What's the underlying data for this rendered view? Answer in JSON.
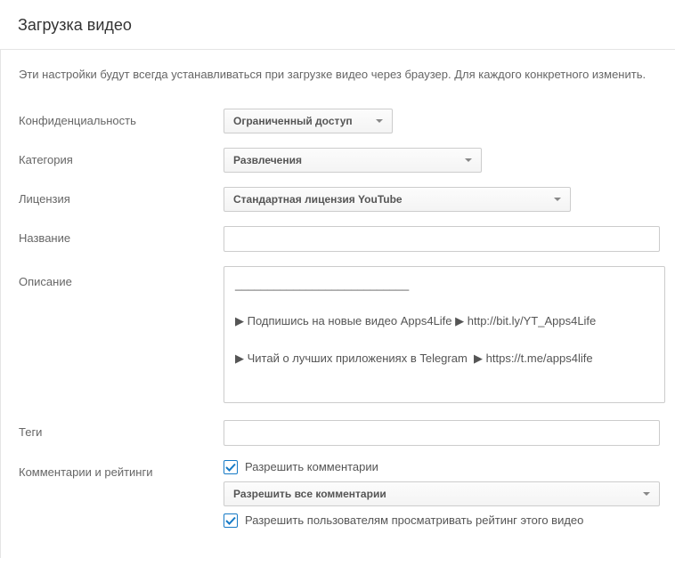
{
  "header": {
    "title": "Загрузка видео"
  },
  "intro": "Эти настройки будут всегда устанавливаться при загрузке видео через браузер. Для каждого конкретного изменить.",
  "privacy": {
    "label": "Конфиденциальность",
    "value": "Ограниченный доступ"
  },
  "category": {
    "label": "Категория",
    "value": "Развлечения"
  },
  "license": {
    "label": "Лицензия",
    "value": "Стандартная лицензия YouTube"
  },
  "title_field": {
    "label": "Название",
    "value": ""
  },
  "description": {
    "label": "Описание",
    "value": "___________________________\n\n▶ Подпишись на новые видео Apps4Life ▶ http://bit.ly/YT_Apps4Life\n\n▶ Читай о лучших приложениях в Telegram  ▶ https://t.me/apps4life"
  },
  "tags": {
    "label": "Теги",
    "value": ""
  },
  "comments": {
    "label": "Комментарии и рейтинги",
    "allow_comments_label": "Разрешить комментарии",
    "allow_comments_checked": true,
    "comments_mode": "Разрешить все комментарии",
    "allow_ratings_label": "Разрешить пользователям просматривать рейтинг этого видео",
    "allow_ratings_checked": true
  }
}
